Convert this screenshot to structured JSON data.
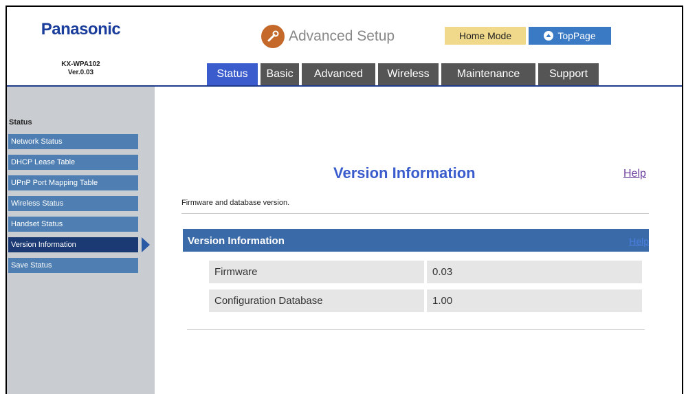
{
  "header": {
    "brand": "Panasonic",
    "model": "KX-WPA102",
    "version": "Ver.0.03",
    "advanced_setup": "Advanced Setup",
    "home_mode": "Home Mode",
    "top_page": "TopPage"
  },
  "tabs": [
    {
      "label": "Status",
      "active": true
    },
    {
      "label": "Basic"
    },
    {
      "label": "Advanced"
    },
    {
      "label": "Wireless"
    },
    {
      "label": "Maintenance"
    },
    {
      "label": "Support"
    }
  ],
  "sidebar": {
    "title": "Status",
    "items": [
      {
        "label": "Network Status"
      },
      {
        "label": "DHCP Lease Table"
      },
      {
        "label": "UPnP Port Mapping Table"
      },
      {
        "label": "Wireless Status"
      },
      {
        "label": "Handset Status"
      },
      {
        "label": "Version Information",
        "active": true
      },
      {
        "label": "Save Status"
      }
    ]
  },
  "main": {
    "title": "Version Information",
    "help_label": "Help",
    "description": "Firmware and database version.",
    "panel": {
      "title": "Version Information",
      "help_label": "Help",
      "rows": [
        {
          "name": "Firmware",
          "value": "0.03"
        },
        {
          "name": "Configuration Database",
          "value": "1.00"
        }
      ]
    }
  },
  "colors": {
    "accent": "#3a5ccd",
    "sidebar_item": "#4f7fb2",
    "sidebar_active": "#1b3a73",
    "panel": "#3a6aa8",
    "home_mode": "#f0d98a"
  }
}
